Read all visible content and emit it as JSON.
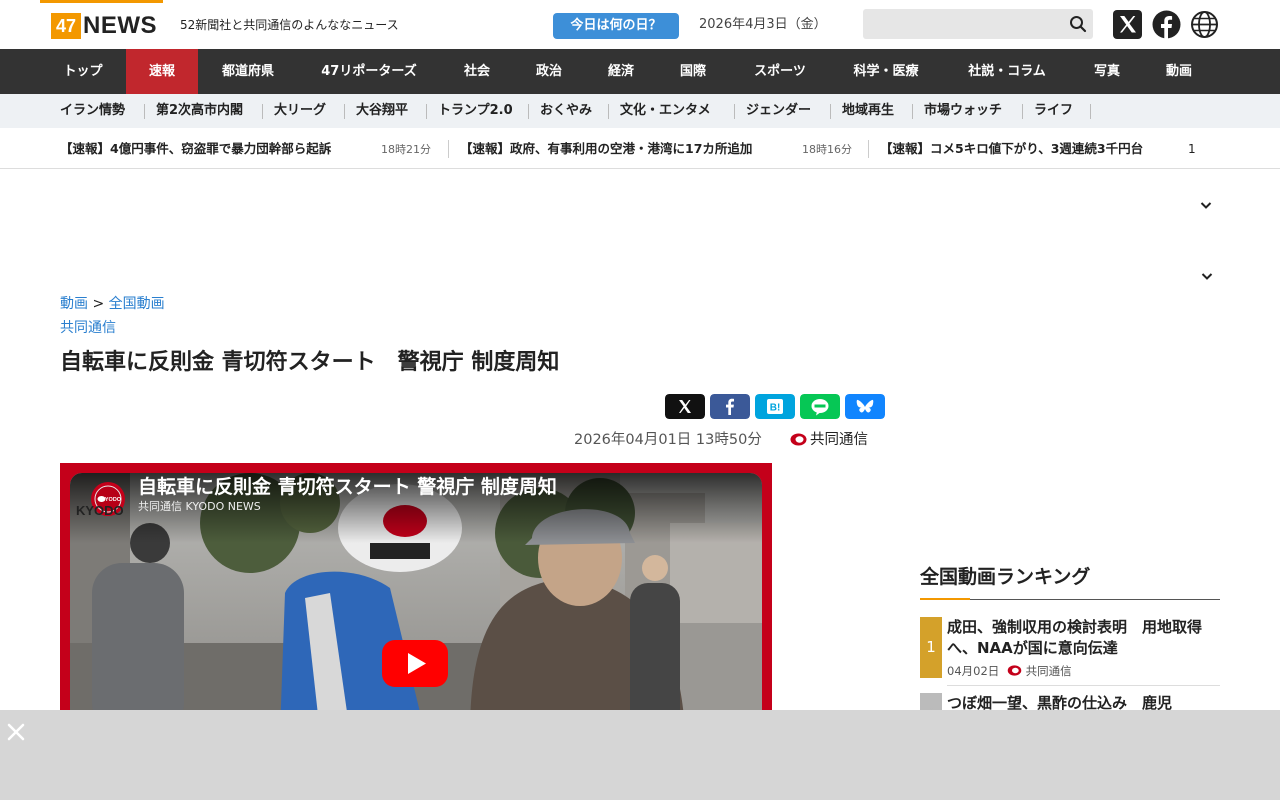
{
  "header": {
    "logo_num": "47",
    "logo_word": "NEWS",
    "tagline": "52新聞社と共同通信のよんななニュース",
    "today_button": "今日は何の日？",
    "date": "2026年4月3日（金）",
    "search_placeholder": "",
    "brand_color": "#f39800"
  },
  "main_nav": {
    "items": [
      "トップ",
      "速報",
      "都道府県",
      "47リポーターズ",
      "社会",
      "政治",
      "経済",
      "国際",
      "スポーツ",
      "科学・医療",
      "社説・コラム",
      "写真",
      "動画"
    ],
    "active": "速報",
    "active_color": "#c1272d"
  },
  "sub_nav": {
    "items": [
      "イラン情勢",
      "第2次高市内閣",
      "大リーグ",
      "大谷翔平",
      "トランプ2.0",
      "おくやみ",
      "文化・エンタメ",
      "ジェンダー",
      "地域再生",
      "市場ウォッチ",
      "ライフ"
    ]
  },
  "ticker": {
    "items": [
      {
        "text": "【速報】4億円事件、窃盗罪で暴力団幹部ら起訴",
        "time": "18時21分"
      },
      {
        "text": "【速報】政府、有事利用の空港・港湾に17カ所追加",
        "time": "18時16分"
      },
      {
        "text": "【速報】コメ5キロ値下がり、3週連続3千円台",
        "time": ""
      }
    ],
    "count": "1"
  },
  "article": {
    "breadcrumb": [
      "動画",
      "全国動画"
    ],
    "breadcrumb_sep": ">",
    "source": "共同通信",
    "title": "自転車に反則金 青切符スタート　警視庁 制度周知",
    "published": "2026年04月01日 13時50分",
    "publisher": "共同通信"
  },
  "video": {
    "title": "自転車に反則金 青切符スタート 警視庁 制度周知",
    "channel": "共同通信 KYODO NEWS",
    "avatar_text": "KYODO",
    "watermark": "KYODO"
  },
  "ranking": {
    "heading": "全国動画ランキング",
    "items": [
      {
        "rank": "1",
        "title": "成田、強制収用の検討表明　用地取得へ、NAAが国に意向伝達",
        "date": "04月02日",
        "source": "共同通信",
        "color": "#d4a12a"
      },
      {
        "rank": "2",
        "title": "つぼ畑一望、黒酢の仕込み　鹿児",
        "date": "",
        "source": "",
        "color": "#bbbbbb"
      }
    ]
  },
  "ad": {
    "close_icon": "×"
  }
}
